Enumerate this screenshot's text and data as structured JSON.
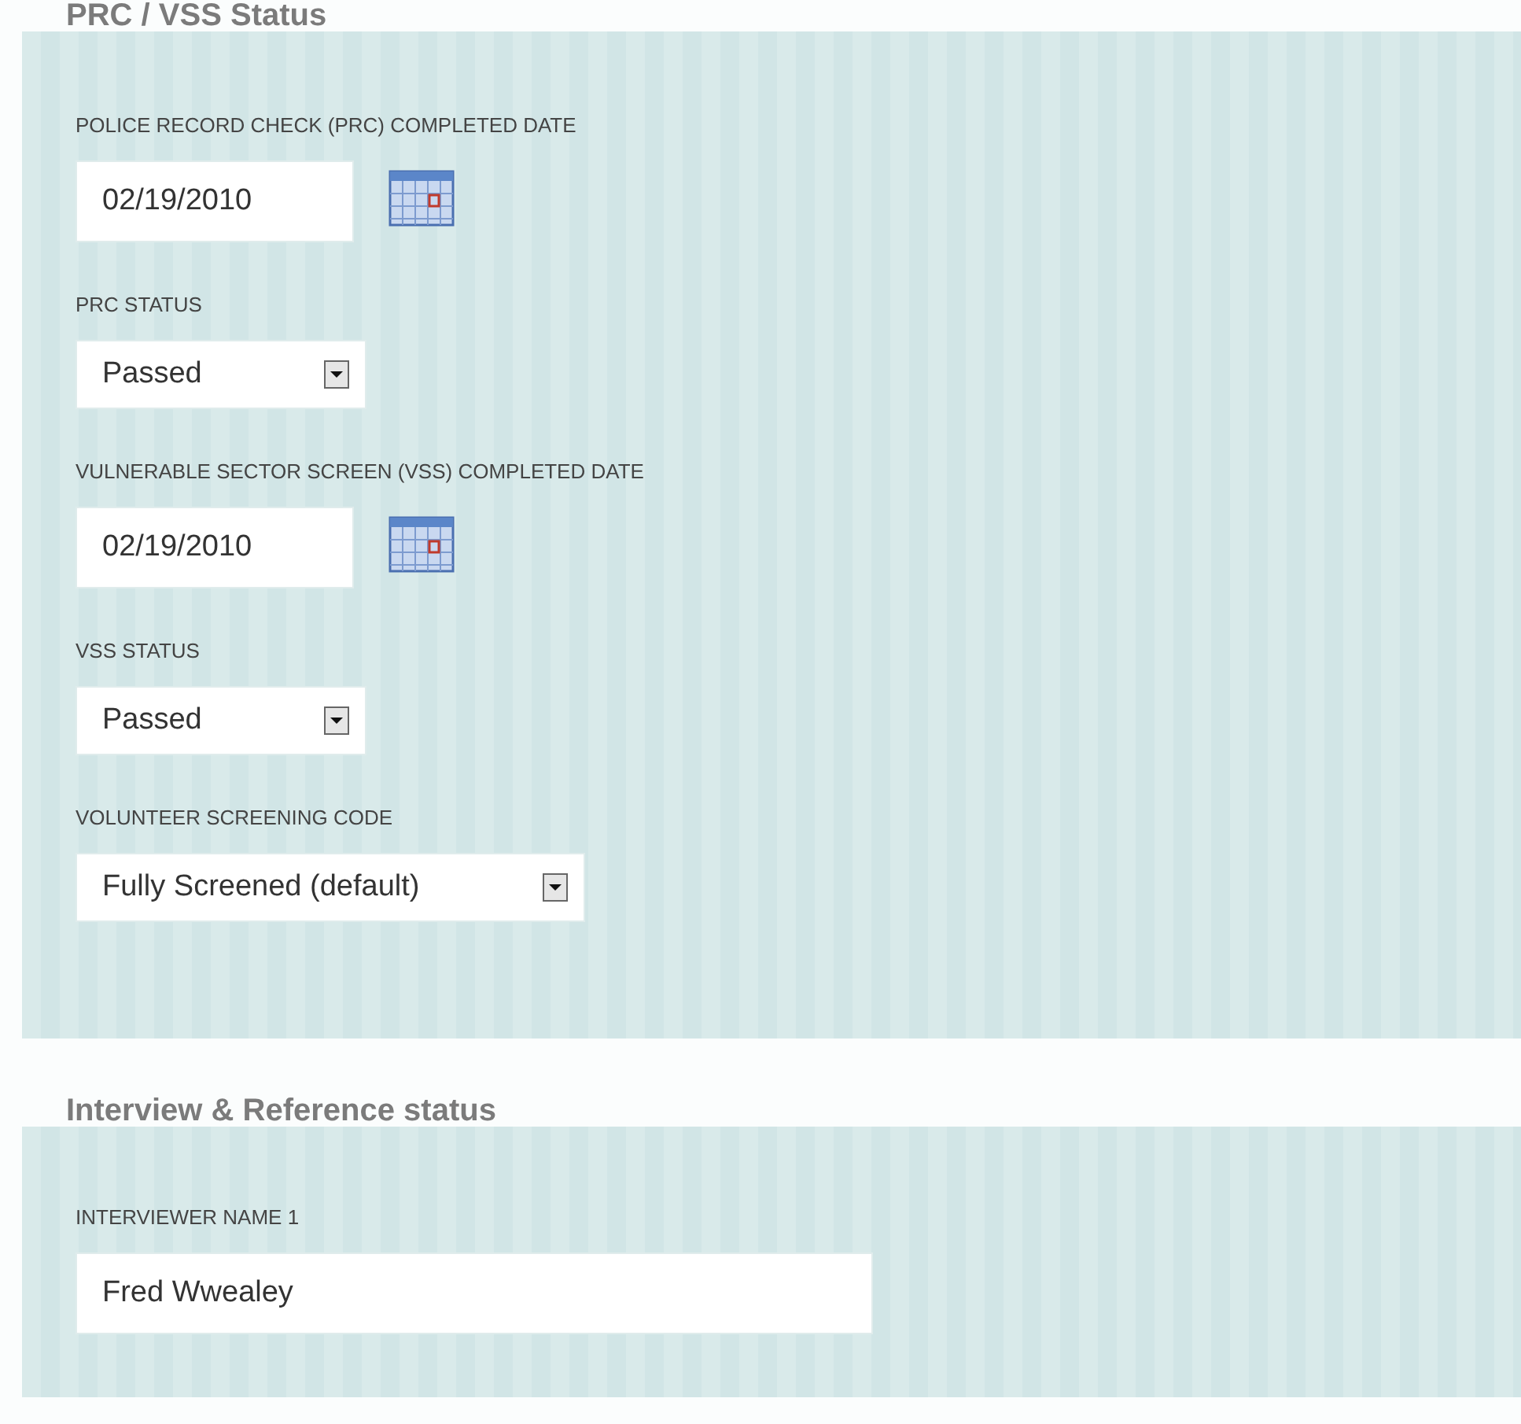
{
  "sections": [
    {
      "title": "PRC / VSS Status",
      "fields": [
        {
          "kind": "date",
          "label": "POLICE RECORD CHECK (PRC) COMPLETED DATE",
          "value": "02/19/2010"
        },
        {
          "kind": "select",
          "label": "PRC STATUS",
          "value": "Passed"
        },
        {
          "kind": "date",
          "label": "VULNERABLE SECTOR SCREEN (VSS) COMPLETED DATE",
          "value": "02/19/2010"
        },
        {
          "kind": "select",
          "label": "VSS STATUS",
          "value": "Passed"
        },
        {
          "kind": "select",
          "label": "VOLUNTEER SCREENING CODE",
          "value": "Fully Screened (default)"
        }
      ]
    },
    {
      "title": "Interview & Reference status",
      "fields": [
        {
          "kind": "text",
          "label": "INTERVIEWER NAME 1",
          "value": "Fred Wwealey"
        }
      ]
    }
  ]
}
